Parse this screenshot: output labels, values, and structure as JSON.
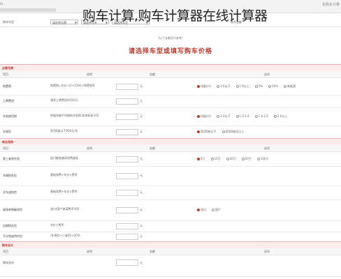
{
  "banner": {
    "title": "购车计算,购车计算器在线计算器"
  },
  "topnav": {
    "left_text": "lo",
    "right_text": "车购车计算"
  },
  "selector": {
    "label": "购车车型",
    "brand_placeholder": "请选择品牌",
    "series_placeholder": "请选择车系",
    "model_placeholder": "请选择车型",
    "right_label": "购车总额"
  },
  "announcement": "(以下金额仅为参考)",
  "headline": "请选择车型或填写购车价格",
  "sections": {
    "required": "必要花费",
    "insurance": "商业保险",
    "total": "购车总计"
  },
  "columns": {
    "item": "项目",
    "desc": "说明",
    "amount": "金额",
    "option": "选项"
  },
  "required_rows": [
    {
      "name": "购置税",
      "desc": "购置税=车价÷(1+13%)×购置税率",
      "unit": "元",
      "options": [
        "排量(升)",
        "1.6以下",
        "1.6以上",
        "5%",
        "10%",
        "新能源"
      ]
    },
    {
      "name": "上牌费用",
      "desc": "通常上牌费用约500元",
      "unit": "元",
      "options": []
    },
    {
      "name": "车船使用税",
      "desc": "根据排量不同缴纳车船税,各地标准不同",
      "unit": "元",
      "options": [
        "排量(升)",
        "1.0以下",
        "1.0-1.6",
        "1.6-2.0",
        "2.0以上"
      ]
    },
    {
      "name": "交强险",
      "desc": "家用6座以下950元/年",
      "unit": "元",
      "options": [
        "家用6座以下",
        "家用6座及以上"
      ]
    }
  ],
  "insurance_rows": [
    {
      "name": "第三者责任险",
      "desc": "赔付额度越高保费越高",
      "unit": "元",
      "options": [
        "5万",
        "10万",
        "20万",
        "50万",
        "100万"
      ]
    },
    {
      "name": "车辆损失险",
      "desc": "基础保费+车价×费率",
      "unit": "元",
      "options": []
    },
    {
      "name": "全车盗抢险",
      "desc": "基础保费+车价×费率",
      "unit": "元",
      "options": []
    },
    {
      "name": "玻璃单独破碎险",
      "desc": "进口/国产玻璃费率不同",
      "unit": "元",
      "options": [
        "进口",
        "国产"
      ]
    },
    {
      "name": "自燃损失险",
      "desc": "车价×费率",
      "unit": "元",
      "options": []
    },
    {
      "name": "不计免赔特约险",
      "desc": "(车损险+三者险)×20%",
      "unit": "元",
      "options": []
    }
  ],
  "total_row": {
    "name": "购车总计",
    "unit": "元"
  }
}
